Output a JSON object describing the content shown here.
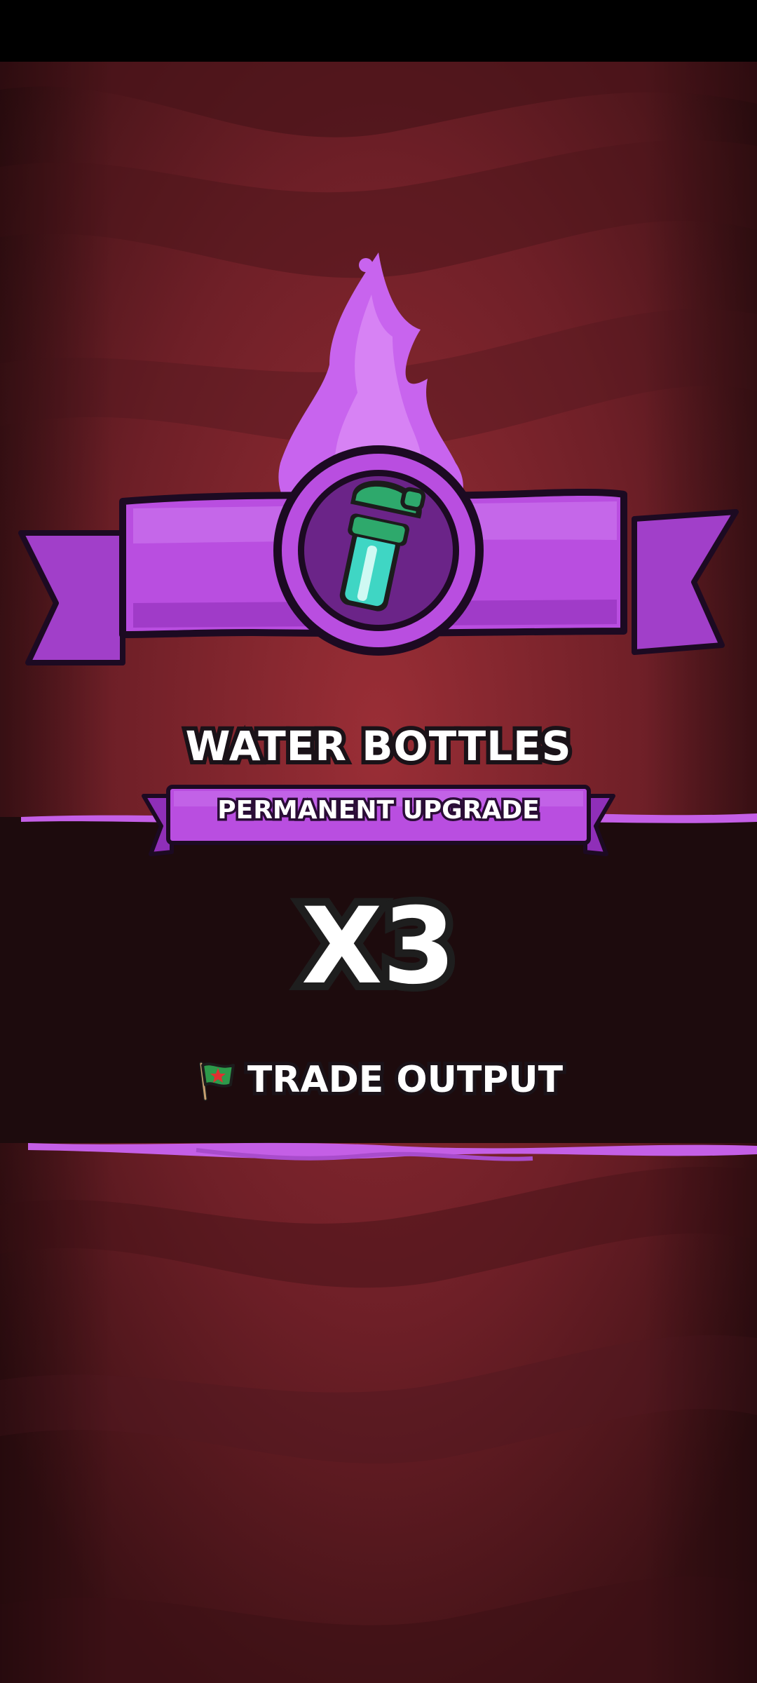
{
  "reward": {
    "item_name": "WATER BOTTLES",
    "upgrade_type": "PERMANENT UPGRADE",
    "multiplier": "X3",
    "effect_label": "TRADE OUTPUT",
    "item_icon": "water-bottle-icon",
    "effect_icon": "flag-icon"
  },
  "colors": {
    "background_red": "#6e1f27",
    "background_dark": "#1d0b0d",
    "accent_purple": "#b94ee0",
    "flame_purple": "#c864ee",
    "bottle_teal": "#3fd6c4"
  }
}
